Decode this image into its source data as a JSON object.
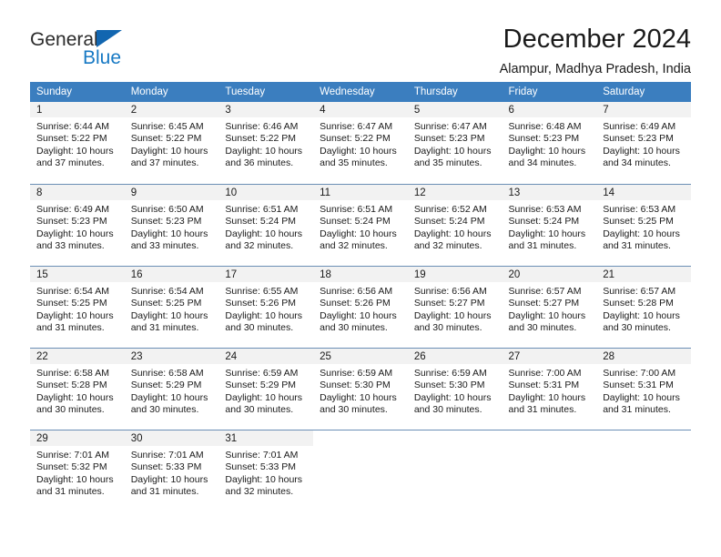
{
  "brand": {
    "line1": "General",
    "line2": "Blue",
    "triangle_color": "#1266b0",
    "blue_text_color": "#1779c4"
  },
  "header": {
    "title": "December 2024",
    "subtitle": "Alampur, Madhya Pradesh, India"
  },
  "theme": {
    "header_bg": "#3b7ebf",
    "header_text": "#ffffff",
    "daynum_band_bg": "#f2f2f2",
    "row_divider": "#6b8fb5"
  },
  "weekday_headers": [
    "Sunday",
    "Monday",
    "Tuesday",
    "Wednesday",
    "Thursday",
    "Friday",
    "Saturday"
  ],
  "labels": {
    "sunrise_prefix": "Sunrise:",
    "sunset_prefix": "Sunset:",
    "daylight_prefix": "Daylight:"
  },
  "weeks": [
    [
      {
        "day": "1",
        "sunrise": "Sunrise: 6:44 AM",
        "sunset": "Sunset: 5:22 PM",
        "daylight_l1": "Daylight: 10 hours",
        "daylight_l2": "and 37 minutes."
      },
      {
        "day": "2",
        "sunrise": "Sunrise: 6:45 AM",
        "sunset": "Sunset: 5:22 PM",
        "daylight_l1": "Daylight: 10 hours",
        "daylight_l2": "and 37 minutes."
      },
      {
        "day": "3",
        "sunrise": "Sunrise: 6:46 AM",
        "sunset": "Sunset: 5:22 PM",
        "daylight_l1": "Daylight: 10 hours",
        "daylight_l2": "and 36 minutes."
      },
      {
        "day": "4",
        "sunrise": "Sunrise: 6:47 AM",
        "sunset": "Sunset: 5:22 PM",
        "daylight_l1": "Daylight: 10 hours",
        "daylight_l2": "and 35 minutes."
      },
      {
        "day": "5",
        "sunrise": "Sunrise: 6:47 AM",
        "sunset": "Sunset: 5:23 PM",
        "daylight_l1": "Daylight: 10 hours",
        "daylight_l2": "and 35 minutes."
      },
      {
        "day": "6",
        "sunrise": "Sunrise: 6:48 AM",
        "sunset": "Sunset: 5:23 PM",
        "daylight_l1": "Daylight: 10 hours",
        "daylight_l2": "and 34 minutes."
      },
      {
        "day": "7",
        "sunrise": "Sunrise: 6:49 AM",
        "sunset": "Sunset: 5:23 PM",
        "daylight_l1": "Daylight: 10 hours",
        "daylight_l2": "and 34 minutes."
      }
    ],
    [
      {
        "day": "8",
        "sunrise": "Sunrise: 6:49 AM",
        "sunset": "Sunset: 5:23 PM",
        "daylight_l1": "Daylight: 10 hours",
        "daylight_l2": "and 33 minutes."
      },
      {
        "day": "9",
        "sunrise": "Sunrise: 6:50 AM",
        "sunset": "Sunset: 5:23 PM",
        "daylight_l1": "Daylight: 10 hours",
        "daylight_l2": "and 33 minutes."
      },
      {
        "day": "10",
        "sunrise": "Sunrise: 6:51 AM",
        "sunset": "Sunset: 5:24 PM",
        "daylight_l1": "Daylight: 10 hours",
        "daylight_l2": "and 32 minutes."
      },
      {
        "day": "11",
        "sunrise": "Sunrise: 6:51 AM",
        "sunset": "Sunset: 5:24 PM",
        "daylight_l1": "Daylight: 10 hours",
        "daylight_l2": "and 32 minutes."
      },
      {
        "day": "12",
        "sunrise": "Sunrise: 6:52 AM",
        "sunset": "Sunset: 5:24 PM",
        "daylight_l1": "Daylight: 10 hours",
        "daylight_l2": "and 32 minutes."
      },
      {
        "day": "13",
        "sunrise": "Sunrise: 6:53 AM",
        "sunset": "Sunset: 5:24 PM",
        "daylight_l1": "Daylight: 10 hours",
        "daylight_l2": "and 31 minutes."
      },
      {
        "day": "14",
        "sunrise": "Sunrise: 6:53 AM",
        "sunset": "Sunset: 5:25 PM",
        "daylight_l1": "Daylight: 10 hours",
        "daylight_l2": "and 31 minutes."
      }
    ],
    [
      {
        "day": "15",
        "sunrise": "Sunrise: 6:54 AM",
        "sunset": "Sunset: 5:25 PM",
        "daylight_l1": "Daylight: 10 hours",
        "daylight_l2": "and 31 minutes."
      },
      {
        "day": "16",
        "sunrise": "Sunrise: 6:54 AM",
        "sunset": "Sunset: 5:25 PM",
        "daylight_l1": "Daylight: 10 hours",
        "daylight_l2": "and 31 minutes."
      },
      {
        "day": "17",
        "sunrise": "Sunrise: 6:55 AM",
        "sunset": "Sunset: 5:26 PM",
        "daylight_l1": "Daylight: 10 hours",
        "daylight_l2": "and 30 minutes."
      },
      {
        "day": "18",
        "sunrise": "Sunrise: 6:56 AM",
        "sunset": "Sunset: 5:26 PM",
        "daylight_l1": "Daylight: 10 hours",
        "daylight_l2": "and 30 minutes."
      },
      {
        "day": "19",
        "sunrise": "Sunrise: 6:56 AM",
        "sunset": "Sunset: 5:27 PM",
        "daylight_l1": "Daylight: 10 hours",
        "daylight_l2": "and 30 minutes."
      },
      {
        "day": "20",
        "sunrise": "Sunrise: 6:57 AM",
        "sunset": "Sunset: 5:27 PM",
        "daylight_l1": "Daylight: 10 hours",
        "daylight_l2": "and 30 minutes."
      },
      {
        "day": "21",
        "sunrise": "Sunrise: 6:57 AM",
        "sunset": "Sunset: 5:28 PM",
        "daylight_l1": "Daylight: 10 hours",
        "daylight_l2": "and 30 minutes."
      }
    ],
    [
      {
        "day": "22",
        "sunrise": "Sunrise: 6:58 AM",
        "sunset": "Sunset: 5:28 PM",
        "daylight_l1": "Daylight: 10 hours",
        "daylight_l2": "and 30 minutes."
      },
      {
        "day": "23",
        "sunrise": "Sunrise: 6:58 AM",
        "sunset": "Sunset: 5:29 PM",
        "daylight_l1": "Daylight: 10 hours",
        "daylight_l2": "and 30 minutes."
      },
      {
        "day": "24",
        "sunrise": "Sunrise: 6:59 AM",
        "sunset": "Sunset: 5:29 PM",
        "daylight_l1": "Daylight: 10 hours",
        "daylight_l2": "and 30 minutes."
      },
      {
        "day": "25",
        "sunrise": "Sunrise: 6:59 AM",
        "sunset": "Sunset: 5:30 PM",
        "daylight_l1": "Daylight: 10 hours",
        "daylight_l2": "and 30 minutes."
      },
      {
        "day": "26",
        "sunrise": "Sunrise: 6:59 AM",
        "sunset": "Sunset: 5:30 PM",
        "daylight_l1": "Daylight: 10 hours",
        "daylight_l2": "and 30 minutes."
      },
      {
        "day": "27",
        "sunrise": "Sunrise: 7:00 AM",
        "sunset": "Sunset: 5:31 PM",
        "daylight_l1": "Daylight: 10 hours",
        "daylight_l2": "and 31 minutes."
      },
      {
        "day": "28",
        "sunrise": "Sunrise: 7:00 AM",
        "sunset": "Sunset: 5:31 PM",
        "daylight_l1": "Daylight: 10 hours",
        "daylight_l2": "and 31 minutes."
      }
    ],
    [
      {
        "day": "29",
        "sunrise": "Sunrise: 7:01 AM",
        "sunset": "Sunset: 5:32 PM",
        "daylight_l1": "Daylight: 10 hours",
        "daylight_l2": "and 31 minutes."
      },
      {
        "day": "30",
        "sunrise": "Sunrise: 7:01 AM",
        "sunset": "Sunset: 5:33 PM",
        "daylight_l1": "Daylight: 10 hours",
        "daylight_l2": "and 31 minutes."
      },
      {
        "day": "31",
        "sunrise": "Sunrise: 7:01 AM",
        "sunset": "Sunset: 5:33 PM",
        "daylight_l1": "Daylight: 10 hours",
        "daylight_l2": "and 32 minutes."
      },
      {
        "day": "",
        "sunrise": "",
        "sunset": "",
        "daylight_l1": "",
        "daylight_l2": ""
      },
      {
        "day": "",
        "sunrise": "",
        "sunset": "",
        "daylight_l1": "",
        "daylight_l2": ""
      },
      {
        "day": "",
        "sunrise": "",
        "sunset": "",
        "daylight_l1": "",
        "daylight_l2": ""
      },
      {
        "day": "",
        "sunrise": "",
        "sunset": "",
        "daylight_l1": "",
        "daylight_l2": ""
      }
    ]
  ]
}
